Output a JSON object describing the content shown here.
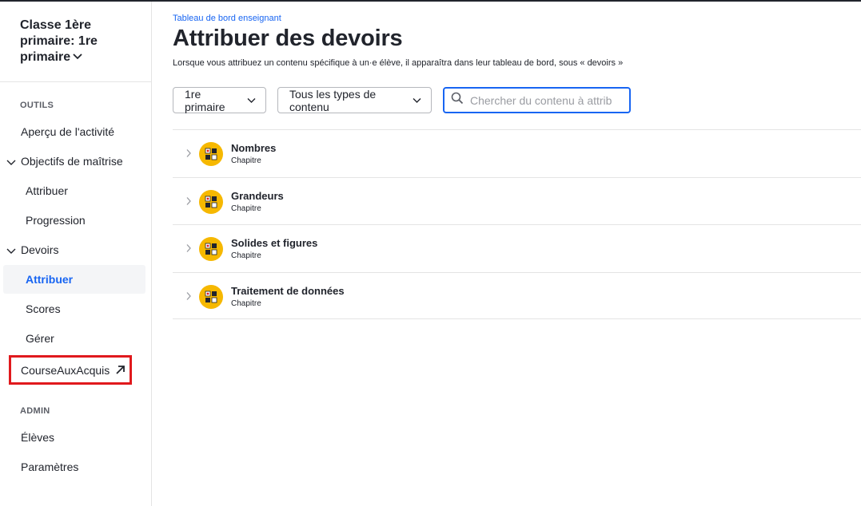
{
  "sidebar": {
    "class_name": "Classe 1ère primaire: 1re primaire",
    "sections": {
      "tools": "OUTILS",
      "admin": "ADMIN"
    },
    "items": {
      "activity_overview": "Aperçu de l'activité",
      "mastery_goals": "Objectifs de maîtrise",
      "mastery_assign": "Attribuer",
      "mastery_progress": "Progression",
      "assignments": "Devoirs",
      "assignments_assign": "Attribuer",
      "assignments_scores": "Scores",
      "assignments_manage": "Gérer",
      "course_link": "CourseAuxAcquis",
      "students": "Élèves",
      "settings": "Paramètres"
    },
    "active_item": "assignments_assign"
  },
  "main": {
    "breadcrumb": "Tableau de bord enseignant",
    "title": "Attribuer des devoirs",
    "description": "Lorsque vous attribuez un contenu spécifique à un·e élève, il apparaîtra dans leur tableau de bord, sous « devoirs »",
    "filters": {
      "grade": "1re primaire",
      "content_type": "Tous les types de contenu",
      "search_placeholder": "Chercher du contenu à attrib"
    },
    "chapters": [
      {
        "title": "Nombres",
        "type": "Chapitre"
      },
      {
        "title": "Grandeurs",
        "type": "Chapitre"
      },
      {
        "title": "Solides et figures",
        "type": "Chapitre"
      },
      {
        "title": "Traitement de données",
        "type": "Chapitre"
      }
    ]
  },
  "colors": {
    "accent": "#1865f2",
    "chapter_icon": "#f6b800",
    "highlight_border": "#e0191d"
  },
  "icons": {
    "class_dropdown": "chevron-down-icon",
    "external_link": "arrow-up-right-icon",
    "search": "search-icon",
    "row_expand": "chevron-right-icon",
    "chapter": "chapter-blocks-icon"
  }
}
